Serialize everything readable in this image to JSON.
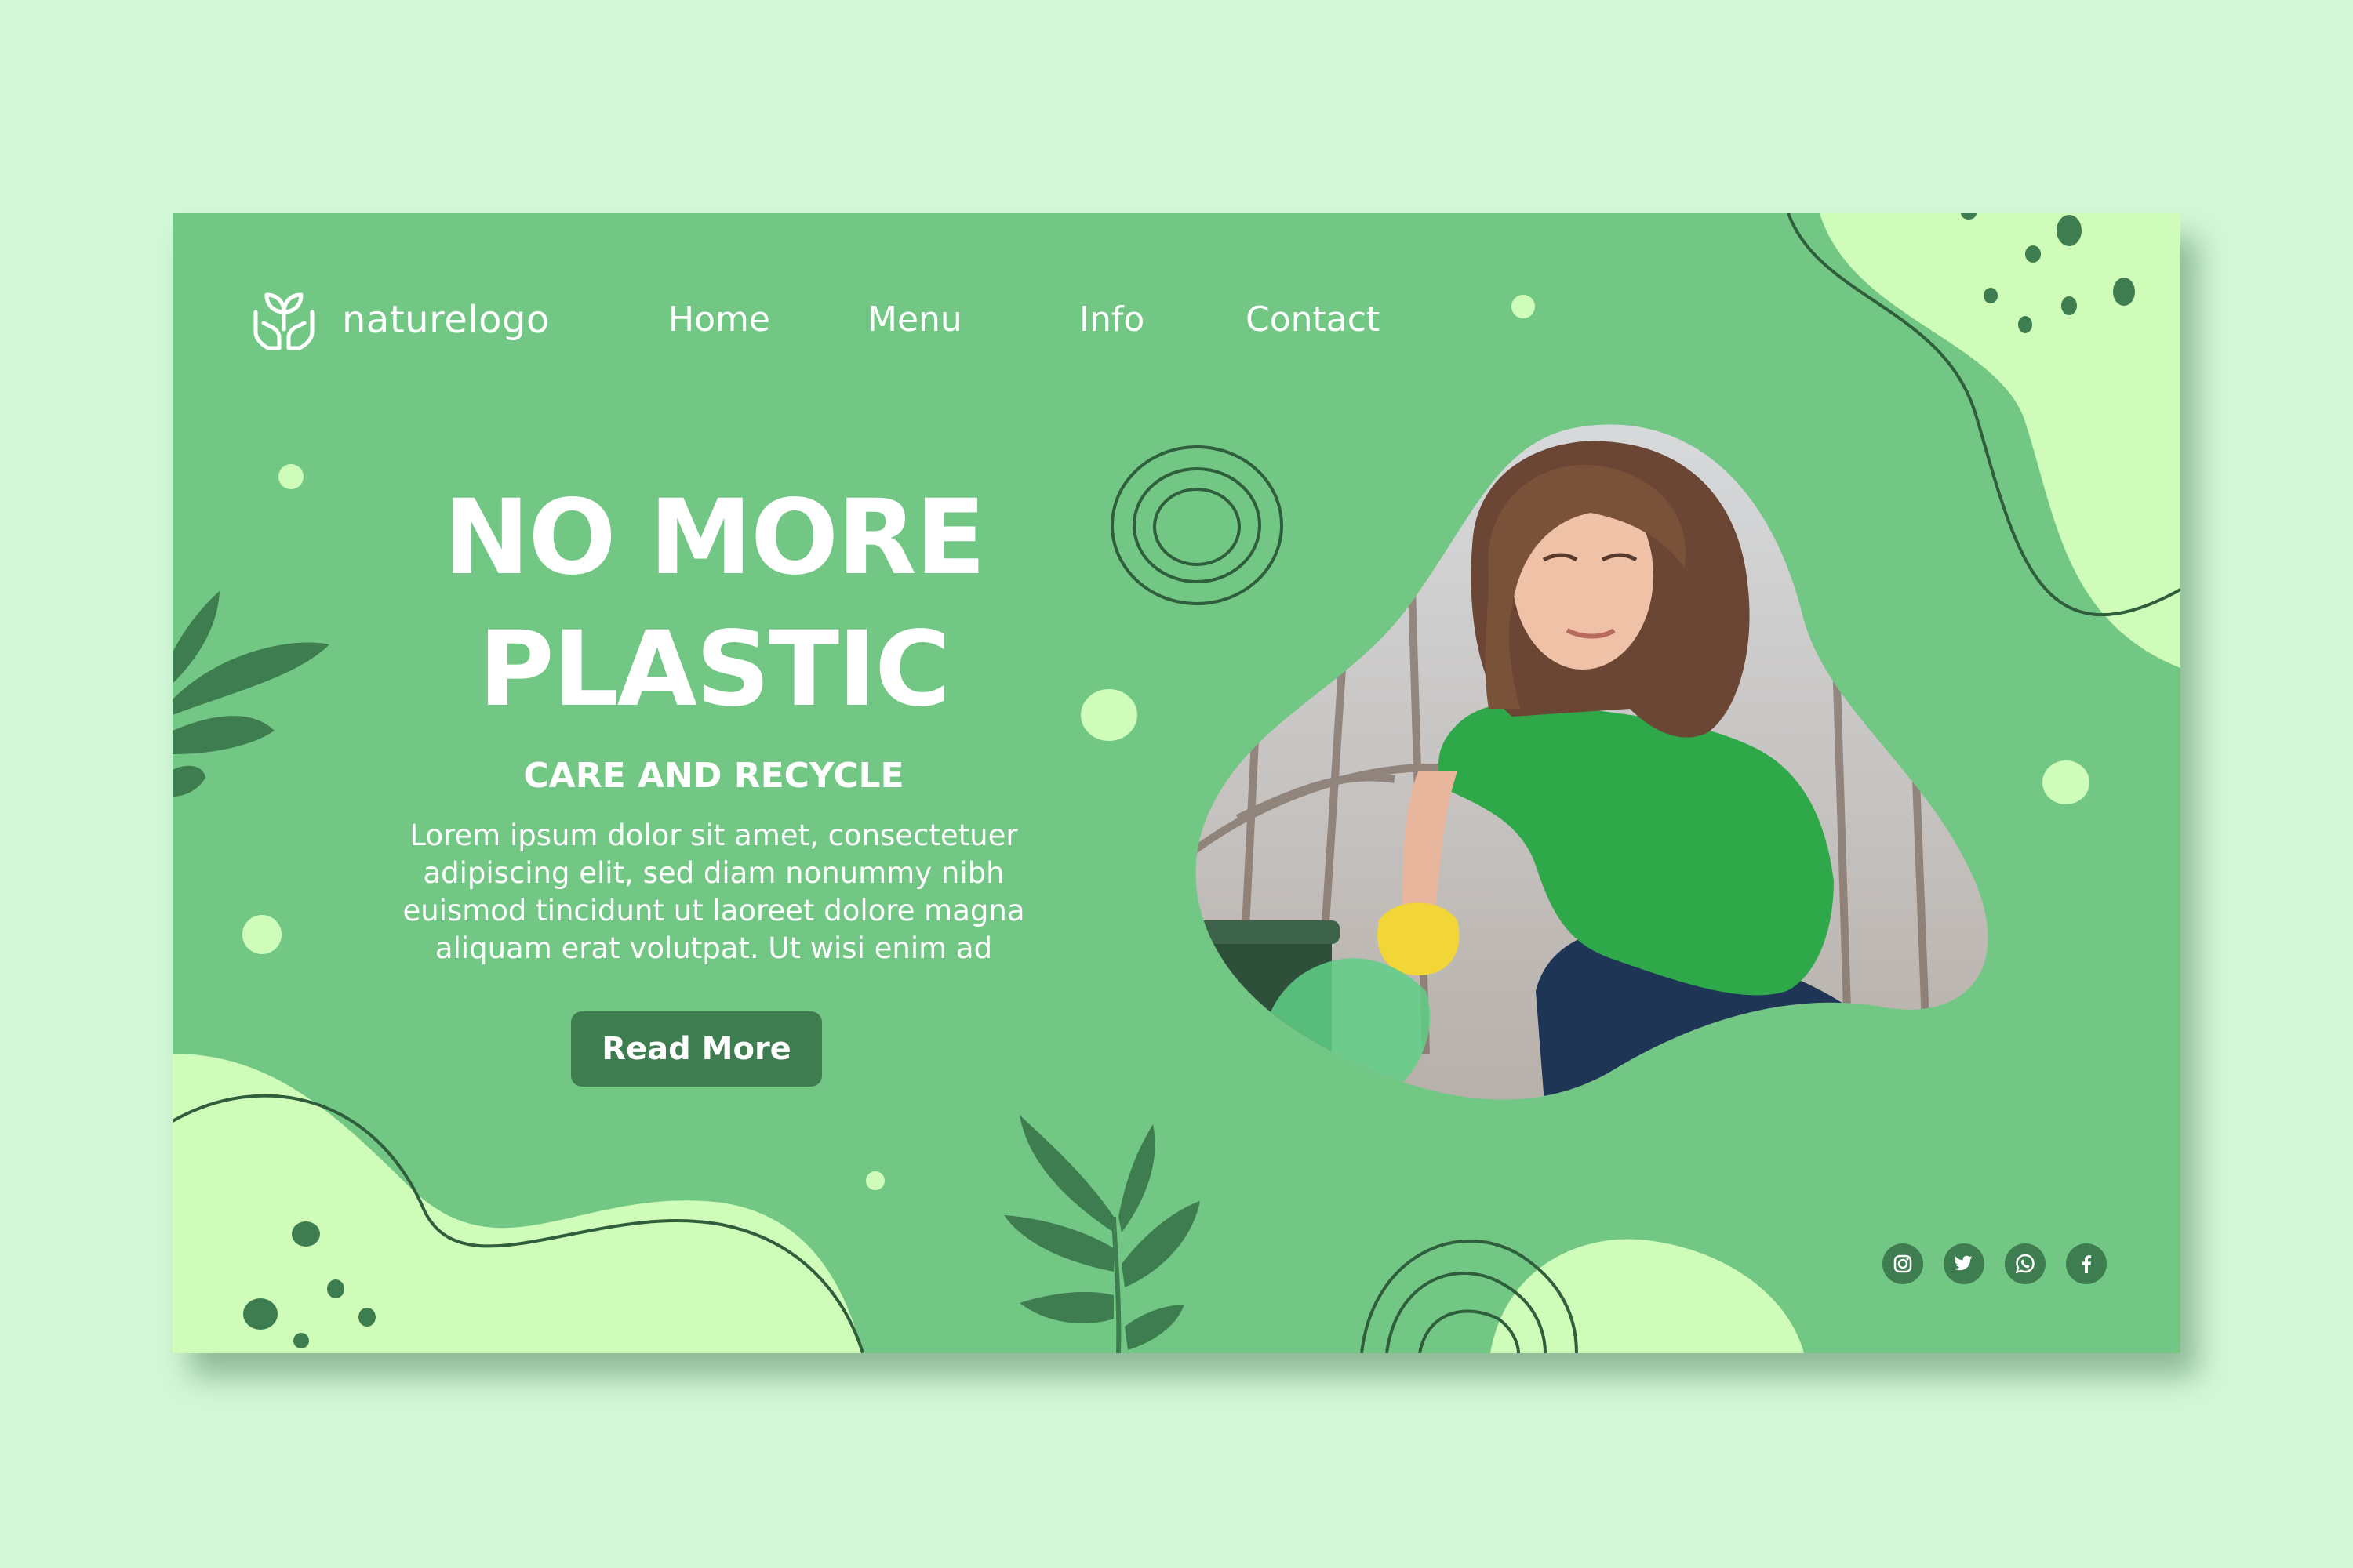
{
  "brand": {
    "name": "naturelogo",
    "icon": "plant-hands-icon"
  },
  "nav": {
    "items": [
      {
        "label": "Home"
      },
      {
        "label": "Menu"
      },
      {
        "label": "Info"
      },
      {
        "label": "Contact"
      }
    ]
  },
  "hero": {
    "headline_line1": "NO MORE",
    "headline_line2": "PLASTIC",
    "subheading": "CARE AND RECYCLE",
    "body_lines": [
      "Lorem ipsum dolor sit amet, consectetuer",
      "adipiscing elit, sed diam nonummy nibh",
      "euismod tincidunt ut laoreet dolore magna",
      "aliquam erat volutpat. Ut wisi enim ad"
    ],
    "cta_label": "Read More"
  },
  "social": [
    {
      "icon": "instagram-icon"
    },
    {
      "icon": "twitter-icon"
    },
    {
      "icon": "whatsapp-icon"
    },
    {
      "icon": "facebook-icon"
    }
  ],
  "colors": {
    "page_background": "#d3f8d8",
    "card_background": "#73c784",
    "light_blob": "#cffcb8",
    "dark_green": "#3d7d4f",
    "leaf_green": "#4a9560"
  }
}
